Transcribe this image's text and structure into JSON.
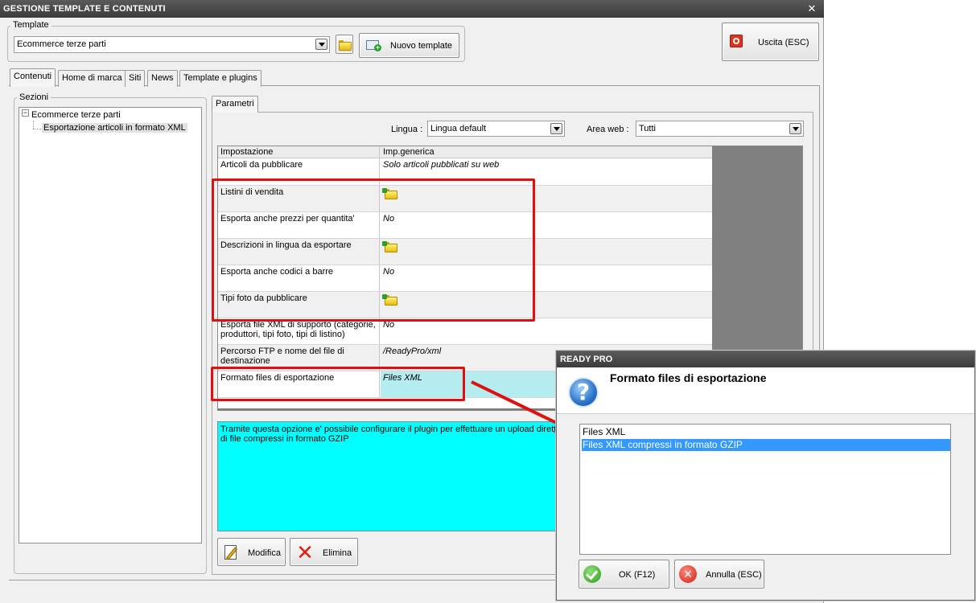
{
  "window": {
    "title": "GESTIONE TEMPLATE E CONTENUTI",
    "close_glyph": "✕"
  },
  "template_group": {
    "legend": "Template",
    "selected": "Ecommerce terze parti",
    "new_button": "Nuovo template"
  },
  "exit_button": "Uscita (ESC)",
  "tabs": [
    {
      "label": "Contenuti",
      "active": true
    },
    {
      "label": "Home di marca",
      "active": false
    },
    {
      "label": "Siti",
      "active": false
    },
    {
      "label": "News",
      "active": false
    },
    {
      "label": "Template e plugins",
      "active": false
    }
  ],
  "sections": {
    "legend": "Sezioni",
    "tree": [
      {
        "label": "Ecommerce terze parti",
        "expander": "−"
      },
      {
        "label": "Esportazione articoli in formato XML"
      }
    ]
  },
  "params": {
    "tab_label": "Parametri",
    "language_label": "Lingua :",
    "language_value": "Lingua default",
    "area_label": "Area web :",
    "area_value": "Tutti",
    "header": {
      "setting": "Impostazione",
      "value": "Imp.generica"
    },
    "rows": [
      {
        "setting": "Articoli da pubblicare",
        "value": "Solo articoli pubblicati su web"
      },
      {
        "setting": "Listini di vendita",
        "value": "",
        "icon": "folder-add-icon"
      },
      {
        "setting": "Esporta anche prezzi per quantita'",
        "value": "No"
      },
      {
        "setting": "Descrizioni in lingua da esportare",
        "value": "",
        "icon": "folder-add-icon"
      },
      {
        "setting": "Esporta anche codici a barre",
        "value": "No"
      },
      {
        "setting": "Tipi foto da pubblicare",
        "value": "",
        "icon": "folder-add-icon"
      },
      {
        "setting": "Esporta file XML di supporto (categorie, produttori, tipi foto, tipi di listino)",
        "value": "No"
      },
      {
        "setting": "Percorso FTP e nome del file di destinazione",
        "value": "/ReadyPro/xml"
      },
      {
        "setting": "Formato files di esportazione",
        "value": "Files XML"
      }
    ],
    "description": "Tramite questa opzione e' possibile configurare il plugin per effettuare un upload diretto di file compressi in formato GZIP"
  },
  "bottom_buttons": {
    "modify": "Modifica",
    "delete": "Elimina"
  },
  "dialog": {
    "title": "READY PRO",
    "question_glyph": "?",
    "heading": "Formato files di esportazione",
    "options": [
      {
        "label": "Files XML",
        "selected": false
      },
      {
        "label": "Files XML compressi in formato GZIP",
        "selected": true
      }
    ],
    "ok_button": "OK (F12)",
    "cancel_button": "Annulla (ESC)",
    "cancel_glyph": "✕"
  },
  "colors": {
    "annotation": "#e01010",
    "description_bg": "#00ffff",
    "selected_cell": "#b4ecf0",
    "list_selection": "#3399ff"
  }
}
